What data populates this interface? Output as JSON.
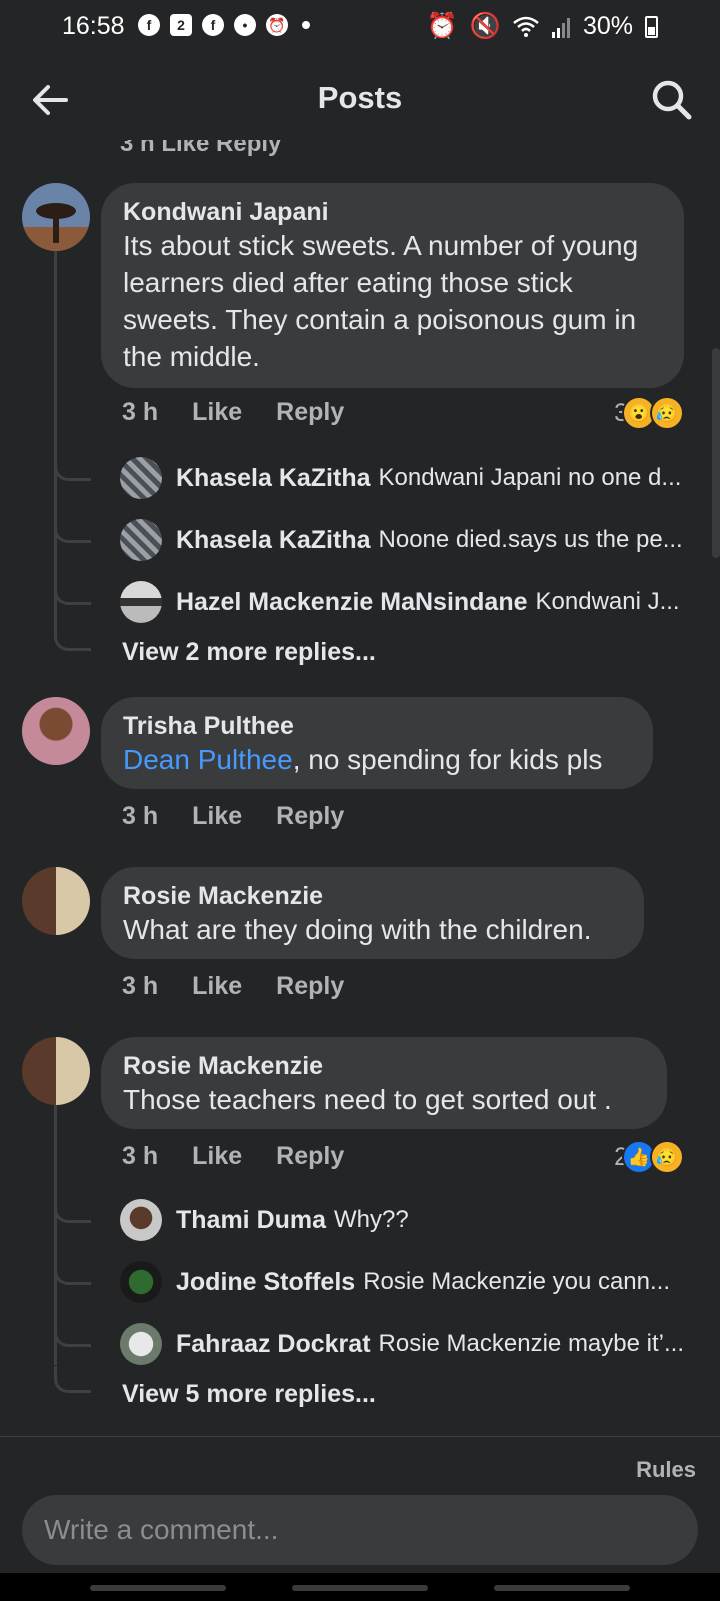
{
  "status_bar": {
    "time": "16:58",
    "notif_badge": "2",
    "battery": "30%",
    "battery_level": 0.3
  },
  "header": {
    "title": "Posts"
  },
  "partial_top": "3 h   Like   Reply",
  "comments": [
    {
      "author": "Kondwani Japani",
      "text": "Its about stick sweets. A number of young learners died after eating those stick sweets. They contain a poisonous gum in the middle.",
      "time": "3 h",
      "like": "Like",
      "reply": "Reply",
      "reaction_count": "3",
      "reactions": [
        "wow",
        "sad"
      ],
      "replies": [
        {
          "author": "Khasela KaZitha",
          "text": "Kondwani Japani no one d..."
        },
        {
          "author": "Khasela KaZitha",
          "text": "Noone died.says us the pe..."
        },
        {
          "author": "Hazel Mackenzie MaNsindane",
          "text": "Kondwani J..."
        }
      ],
      "more": "View 2 more replies..."
    },
    {
      "author": "Trisha Pulthee",
      "mention": "Dean Pulthee",
      "text": ", no spending for kids pls",
      "time": "3 h",
      "like": "Like",
      "reply": "Reply"
    },
    {
      "author": "Rosie Mackenzie",
      "text": "What are they doing with the children.",
      "time": "3 h",
      "like": "Like",
      "reply": "Reply"
    },
    {
      "author": "Rosie Mackenzie",
      "text": "Those teachers need to get sorted out .",
      "time": "3 h",
      "like": "Like",
      "reply": "Reply",
      "reaction_count": "2",
      "reactions": [
        "like",
        "sad"
      ],
      "replies": [
        {
          "author": "Thami Duma",
          "text": "Why??"
        },
        {
          "author": "Jodine Stoffels",
          "text": "Rosie Mackenzie you cann..."
        },
        {
          "author": "Fahraaz Dockrat",
          "text": "Rosie Mackenzie maybe it’..."
        }
      ],
      "more": "View 5 more replies..."
    }
  ],
  "footer": {
    "rules": "Rules",
    "composer_placeholder": "Write a comment..."
  },
  "colors": {
    "background": "#242526",
    "bubble": "#3a3b3c",
    "mention": "#4599ff",
    "secondary_text": "#b0b3b8"
  }
}
